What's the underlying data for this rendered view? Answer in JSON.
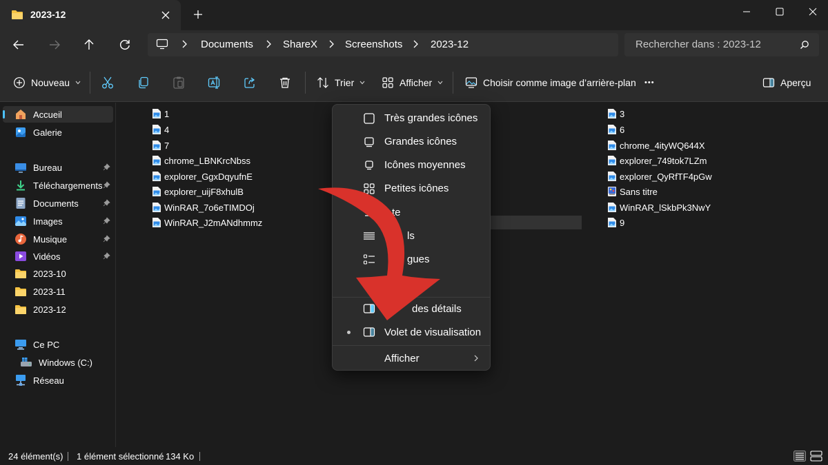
{
  "window": {
    "tab_title": "2023-12",
    "icons": {
      "tab": "folder-icon",
      "close": "close-icon",
      "new_tab": "plus-icon"
    }
  },
  "address": {
    "crumbs": [
      "Documents",
      "ShareX",
      "Screenshots",
      "2023-12"
    ],
    "search_placeholder": "Rechercher dans : 2023-12"
  },
  "toolbar": {
    "new_label": "Nouveau",
    "sort_label": "Trier",
    "view_label": "Afficher",
    "wallpaper_label": "Choisir comme image d’arrière-plan",
    "preview_label": "Aperçu",
    "more_glyph": "•••"
  },
  "sidebar": {
    "items": [
      {
        "label": "Accueil",
        "icon": "home-icon",
        "pinned": false,
        "selected": true
      },
      {
        "label": "Galerie",
        "icon": "gallery-icon",
        "pinned": false
      },
      {
        "label": "Bureau",
        "icon": "desktop-icon",
        "pinned": true
      },
      {
        "label": "Téléchargements",
        "icon": "download-icon",
        "pinned": true
      },
      {
        "label": "Documents",
        "icon": "documents-icon",
        "pinned": true
      },
      {
        "label": "Images",
        "icon": "images-icon",
        "pinned": true
      },
      {
        "label": "Musique",
        "icon": "music-icon",
        "pinned": true
      },
      {
        "label": "Vidéos",
        "icon": "videos-icon",
        "pinned": true
      },
      {
        "label": "2023-10",
        "icon": "folder-icon",
        "pinned": false
      },
      {
        "label": "2023-11",
        "icon": "folder-icon",
        "pinned": false
      },
      {
        "label": "2023-12",
        "icon": "folder-icon",
        "pinned": false
      },
      {
        "label": "Ce PC",
        "icon": "pc-icon",
        "pinned": false
      },
      {
        "label": "Windows (C:)",
        "icon": "drive-icon",
        "pinned": false
      },
      {
        "label": "Réseau",
        "icon": "network-icon",
        "pinned": false
      }
    ]
  },
  "files": {
    "col1": [
      "1",
      "4",
      "7",
      "chrome_LBNKrcNbss",
      "explorer_GgxDqyufnE",
      "explorer_uijF8xhulB",
      "WinRAR_7o6eTIMDOj",
      "WinRAR_J2mANdhmmz"
    ],
    "col3": [
      "3",
      "6",
      "chrome_4ityWQ644X",
      "explorer_749tok7LZm",
      "explorer_QyRfTF4pGw",
      "Sans titre",
      "WinRAR_lSkbPk3NwY",
      "9"
    ]
  },
  "view_menu": {
    "items": [
      {
        "label": "Très grandes icônes",
        "icon": "extra-large-icons-icon"
      },
      {
        "label": "Grandes icônes",
        "icon": "large-icons-icon"
      },
      {
        "label": "Icônes moyennes",
        "icon": "medium-icons-icon"
      },
      {
        "label": "Petites icônes",
        "icon": "small-icons-icon"
      },
      {
        "label": "te",
        "icon": "list-icon"
      },
      {
        "label": "ls",
        "icon": "details-icon"
      },
      {
        "label": "gues",
        "icon": "tiles-icon"
      },
      {
        "label": "",
        "icon": "content-icon"
      }
    ],
    "pane_items": [
      {
        "label": "V",
        "label_rest": "des détails",
        "icon": "details-pane-icon"
      },
      {
        "label": "Volet de visualisation",
        "icon": "preview-pane-icon",
        "checked": true
      }
    ],
    "submenu_label": "Afficher"
  },
  "status": {
    "count": "24 élément(s)",
    "selection": "1 élément sélectionné",
    "size": "134 Ko"
  },
  "colors": {
    "accent": "#4cc2ff",
    "arrow": "#d9322b",
    "folder": "#f6c343",
    "background": "#1c1c1c"
  }
}
